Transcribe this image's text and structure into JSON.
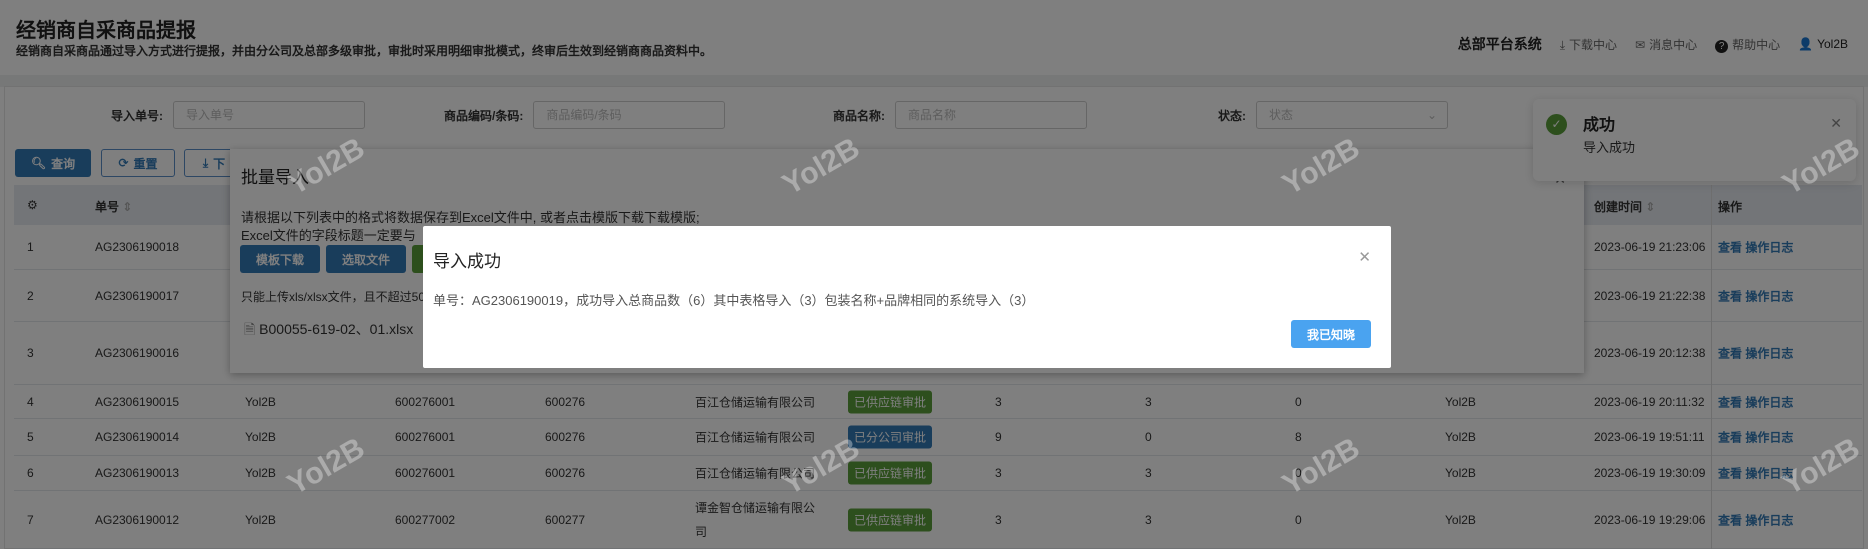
{
  "header": {
    "title": "经销商自采商品提报",
    "subtitle": "经销商自采商品通过导入方式进行提报，并由分公司及总部多级审批，审批时采用明细审批模式，终审后生效到经销商商品资料中。",
    "system": "总部平台系统",
    "download_center": "下载中心",
    "message_center": "消息中心",
    "help_center": "帮助中心",
    "user": "Yol2B"
  },
  "filters": {
    "import_no_label": "导入单号:",
    "import_no_placeholder": "导入单号",
    "code_label": "商品编码/条码:",
    "code_placeholder": "商品编码/条码",
    "name_label": "商品名称:",
    "name_placeholder": "商品名称",
    "status_label": "状态:",
    "status_placeholder": "状态"
  },
  "toolbar": {
    "query": "查询",
    "reset": "重置",
    "download": "下"
  },
  "table": {
    "headers": {
      "no": "单号",
      "created": "创建时间",
      "actions": "操作"
    },
    "view": "查看",
    "log": "操作日志",
    "rows": [
      {
        "idx": "1",
        "no": "AG2306190018",
        "created": "2023-06-19 21:23:06"
      },
      {
        "idx": "2",
        "no": "AG2306190017",
        "created": "2023-06-19 21:22:38"
      },
      {
        "idx": "3",
        "no": "AG2306190016",
        "created": "2023-06-19 20:12:38"
      },
      {
        "idx": "4",
        "no": "AG2306190015",
        "user": "Yol2B",
        "code": "600276001",
        "short": "600276",
        "company": "百江仓储运输有限公司",
        "status": "已供应链审批",
        "n1": "3",
        "n2": "3",
        "n3": "0",
        "creator": "Yol2B",
        "created": "2023-06-19 20:11:32"
      },
      {
        "idx": "5",
        "no": "AG2306190014",
        "user": "Yol2B",
        "code": "600276001",
        "short": "600276",
        "company": "百江仓储运输有限公司",
        "status": "已分公司审批",
        "n1": "9",
        "n2": "0",
        "n3": "8",
        "creator": "Yol2B",
        "created": "2023-06-19 19:51:11"
      },
      {
        "idx": "6",
        "no": "AG2306190013",
        "user": "Yol2B",
        "code": "600276001",
        "short": "600276",
        "company": "百江仓储运输有限公司",
        "status": "已供应链审批",
        "n1": "3",
        "n2": "3",
        "n3": "0",
        "creator": "Yol2B",
        "created": "2023-06-19 19:30:09"
      },
      {
        "idx": "7",
        "no": "AG2306190012",
        "user": "Yol2B",
        "code": "600277002",
        "short": "600277",
        "company": "谭金智仓储运输有限公司",
        "status": "已供应链审批",
        "n1": "3",
        "n2": "3",
        "n3": "0",
        "creator": "Yol2B",
        "created": "2023-06-19 19:29:06"
      }
    ]
  },
  "colors": {
    "green": "#5a9e3a",
    "blue": "#337ab7",
    "primary": "#4aa3f0"
  },
  "batch_dialog": {
    "title": "批量导入",
    "line1": "请根据以下列表中的格式将数据保存到Excel文件中, 或者点击模版下载下载模版;",
    "line2": "Excel文件的字段标题一定要与",
    "template_download": "模板下载",
    "select_file": "选取文件",
    "hint": "只能上传xls/xlsx文件，且不超过50",
    "file": "B00055-619-02、01.xlsx"
  },
  "toast": {
    "title": "成功",
    "message": "导入成功"
  },
  "modal": {
    "title": "导入成功",
    "body": "单号：AG2306190019，成功导入总商品数（6）其中表格导入（3）包装名称+品牌相同的系统导入（3）",
    "ok": "我已知晓"
  },
  "watermark": "Yol2B"
}
